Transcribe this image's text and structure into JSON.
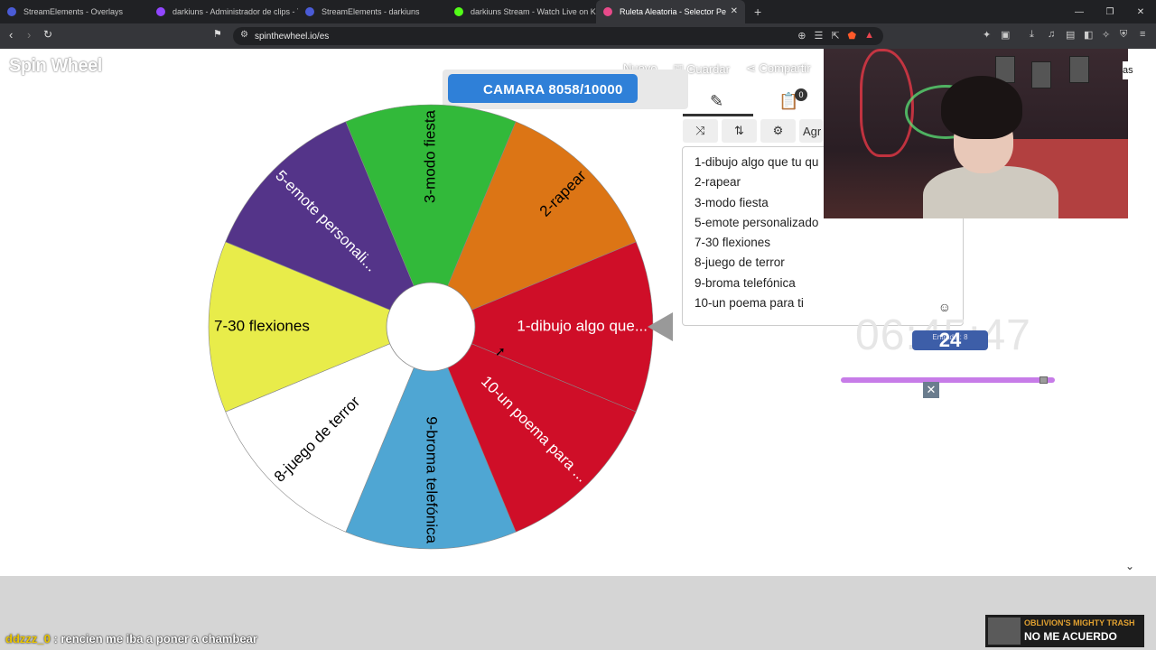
{
  "browser": {
    "tabs": [
      {
        "title": "StreamElements - Overlays",
        "color": "#4a5bd6"
      },
      {
        "title": "darkiuns - Administrador de clips - T",
        "color": "#9146ff"
      },
      {
        "title": "StreamElements - darkiuns",
        "color": "#4a5bd6"
      },
      {
        "title": "darkiuns Stream - Watch Live on Kick",
        "color": "#53fc18"
      },
      {
        "title": "Ruleta Aleatoria - Selector Pe",
        "color": "#e84a8a"
      }
    ],
    "url": "spinthewheel.io/es",
    "new_tab_icon": "plus-icon"
  },
  "app": {
    "logo": "Spin Wheel",
    "menu": [
      "Nuevo",
      "Guardar",
      "Compartir"
    ]
  },
  "overlay": {
    "goal_label": "CAMARA  8058/10000",
    "goal_progress": 0.8058,
    "clock": "06:45:47",
    "counter_value": "24",
    "counter_label": "Entrada : 8",
    "slider_level": 0.98
  },
  "wheel": {
    "segments": [
      {
        "label": "1-dibujo algo que...",
        "color": "#cf0e28",
        "text_color": "#ffffff"
      },
      {
        "label": "10-un poema para ...",
        "color": "#cf0e28",
        "text_color": "#ffffff"
      },
      {
        "label": "9-broma telefónica",
        "color": "#4fa6d3",
        "text_color": "#000000"
      },
      {
        "label": "8-juego de terror",
        "color": "#ffffff",
        "text_color": "#000000"
      },
      {
        "label": "7-30 flexiones",
        "color": "#e8ec4a",
        "text_color": "#000000"
      },
      {
        "label": "5-emote personali...",
        "color": "#543489",
        "text_color": "#ffffff"
      },
      {
        "label": "3-modo fiesta",
        "color": "#32b93a",
        "text_color": "#000000"
      },
      {
        "label": "2-rapear",
        "color": "#dc7515",
        "text_color": "#000000"
      }
    ]
  },
  "panel": {
    "tab_edit_icon": "pencil-icon",
    "tab_results_icon": "clipboard-icon",
    "results_badge": "0",
    "shuffle_icon": "shuffle-icon",
    "sort_icon": "sort-icon",
    "settings_icon": "gear-icon",
    "add_label": "Agr",
    "entries": [
      "1-dibujo algo que tu qu",
      "2-rapear",
      "3-modo fiesta",
      "5-emote personalizado",
      "7-30 flexiones",
      "8-juego de terror",
      "9-broma telefónica",
      "10-un poema para ti"
    ]
  },
  "webcam": {
    "tag": "as"
  },
  "chat": {
    "user": "ddzzz_0",
    "message": ": rencien me iba a poner a chambear"
  },
  "song": {
    "artist": "OBLIVION'S MIGHTY TRASH",
    "title": "NO ME ACUERDO"
  }
}
